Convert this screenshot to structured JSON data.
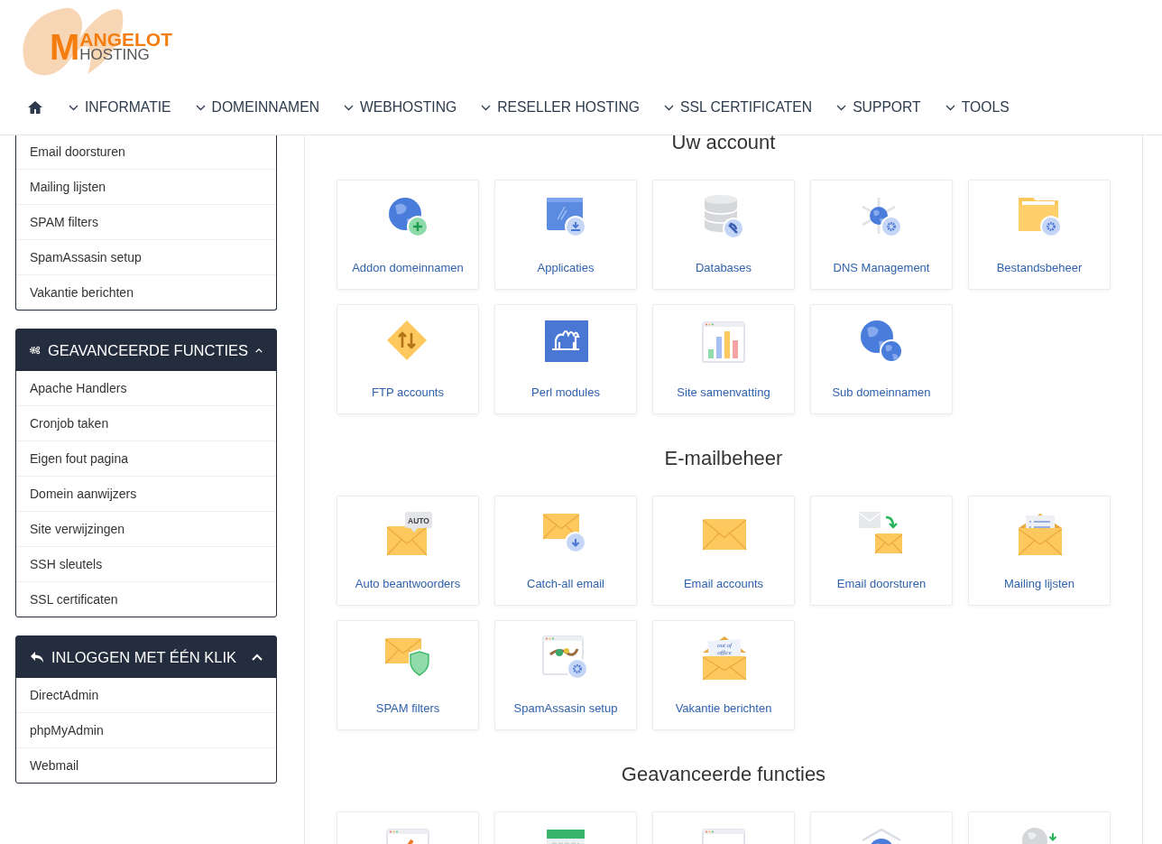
{
  "logo": {
    "initial": "M",
    "line1": "ANGELOT",
    "line2": "HOSTING"
  },
  "nav": [
    {
      "label": "INFORMATIE"
    },
    {
      "label": "DOMEINNAMEN"
    },
    {
      "label": "WEBHOSTING"
    },
    {
      "label": "RESELLER HOSTING"
    },
    {
      "label": "SSL CERTIFICATEN"
    },
    {
      "label": "SUPPORT"
    },
    {
      "label": "TOOLS"
    }
  ],
  "sidebar": {
    "panels": [
      {
        "items": [
          "Email doorsturen",
          "Mailing lijsten",
          "SPAM filters",
          "SpamAssasin setup",
          "Vakantie berichten"
        ]
      },
      {
        "title": "GEAVANCEERDE FUNCTIES",
        "kind": "gears",
        "expanded": true,
        "items": [
          "Apache Handlers",
          "Cronjob taken",
          "Eigen fout pagina",
          "Domein aanwijzers",
          "Site verwijzingen",
          "SSH sleutels",
          "SSL certificaten"
        ]
      },
      {
        "title": "INLOGGEN MET ÉÉN KLIK",
        "kind": "reply",
        "expanded": true,
        "items": [
          "DirectAdmin",
          "phpMyAdmin",
          "Webmail"
        ]
      }
    ]
  },
  "sections": [
    {
      "title": "Uw account",
      "tiles": [
        {
          "kind": "globe-plus",
          "label": "Addon domeinnamen"
        },
        {
          "kind": "app-download",
          "label": "Applicaties"
        },
        {
          "kind": "database",
          "label": "Databases"
        },
        {
          "kind": "dns",
          "label": "DNS Management"
        },
        {
          "kind": "folder-gear",
          "label": "Bestandsbeheer"
        },
        {
          "kind": "ftp",
          "label": "FTP accounts"
        },
        {
          "kind": "perl",
          "label": "Perl modules"
        },
        {
          "kind": "chart",
          "label": "Site samenvatting"
        },
        {
          "kind": "globe-sub",
          "label": "Sub domeinnamen"
        }
      ]
    },
    {
      "title": "E-mailbeheer",
      "tiles": [
        {
          "kind": "mail-auto",
          "label": "Auto beantwoorders",
          "icon_text": "AUTO"
        },
        {
          "kind": "mail-catch",
          "label": "Catch-all email"
        },
        {
          "kind": "mail",
          "label": "Email accounts"
        },
        {
          "kind": "mail-forward",
          "label": "Email doorsturen"
        },
        {
          "kind": "mail-list",
          "label": "Mailing lijsten"
        },
        {
          "kind": "mail-shield",
          "label": "SPAM filters"
        },
        {
          "kind": "spam",
          "label": "SpamAssasin setup"
        },
        {
          "kind": "mail-office",
          "label": "Vakantie berichten",
          "icon_text": "out of office"
        }
      ]
    },
    {
      "title": "Geavanceerde functies",
      "tiles": [
        {
          "kind": "browser-pen"
        },
        {
          "kind": "calendar"
        },
        {
          "kind": "browser"
        },
        {
          "kind": "globe-house"
        },
        {
          "kind": "globe-down"
        }
      ]
    }
  ]
}
